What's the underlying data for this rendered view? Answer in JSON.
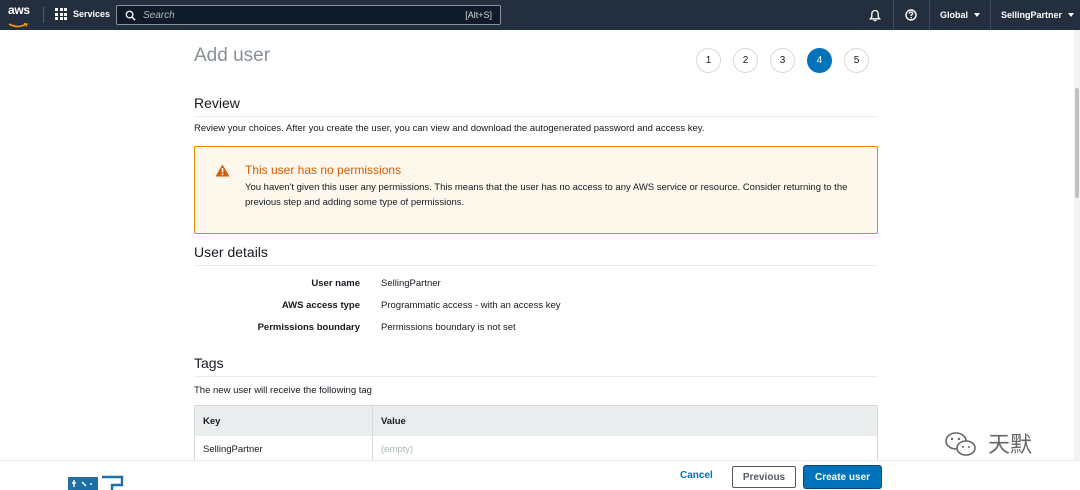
{
  "topnav": {
    "logo_text": "aws",
    "services_label": "Services",
    "search_placeholder": "Search",
    "search_shortcut": "[Alt+S]",
    "region_label": "Global",
    "account_label": "SellingPartner"
  },
  "page": {
    "title": "Add user",
    "steps": [
      "1",
      "2",
      "3",
      "4",
      "5"
    ],
    "active_step": "4"
  },
  "review": {
    "heading": "Review",
    "description": "Review your choices. After you create the user, you can view and download the autogenerated password and access key."
  },
  "alert": {
    "title": "This user has no permissions",
    "body": "You haven't given this user any permissions. This means that the user has no access to any AWS service or resource. Consider returning to the previous step and adding some type of permissions."
  },
  "user_details": {
    "heading": "User details",
    "rows": [
      {
        "key": "User name",
        "value": "SellingPartner"
      },
      {
        "key": "AWS access type",
        "value": "Programmatic access - with an access key"
      },
      {
        "key": "Permissions boundary",
        "value": "Permissions boundary is not set"
      }
    ]
  },
  "tags": {
    "heading": "Tags",
    "description": "The new user will receive the following tag",
    "columns": [
      "Key",
      "Value"
    ],
    "rows": [
      {
        "key": "SellingPartner",
        "value": "(empty)"
      }
    ]
  },
  "footer": {
    "cancel_label": "Cancel",
    "previous_label": "Previous",
    "create_label": "Create user"
  },
  "watermark_text": "天默",
  "colors": {
    "nav_bg": "#232f3e",
    "accent": "#0073bb",
    "warning_border": "#eb8c00",
    "warning_title": "#d45b07",
    "warning_bg": "#fef8ec"
  }
}
